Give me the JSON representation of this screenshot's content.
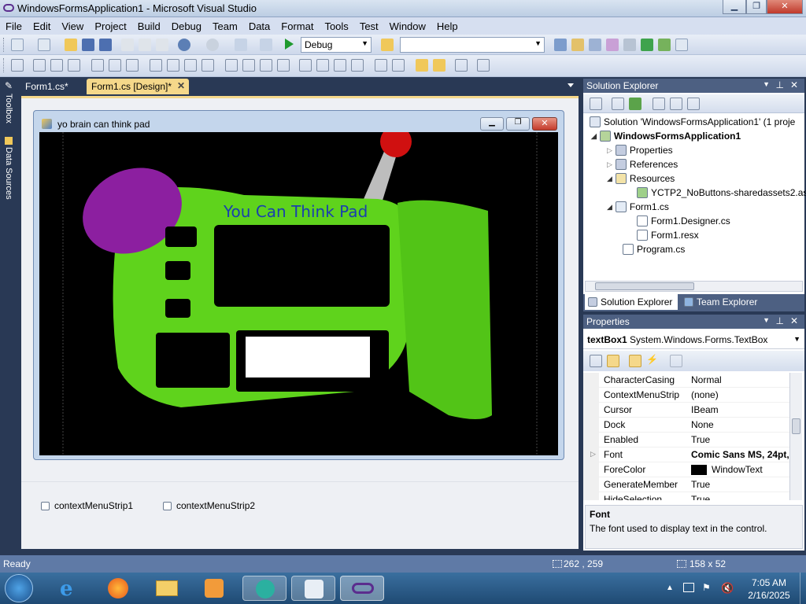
{
  "window": {
    "title": "WindowsFormsApplication1 - Microsoft Visual Studio"
  },
  "menu": [
    "File",
    "Edit",
    "View",
    "Project",
    "Build",
    "Debug",
    "Team",
    "Data",
    "Format",
    "Tools",
    "Test",
    "Window",
    "Help"
  ],
  "toolbar": {
    "config": "Debug"
  },
  "side_tabs": {
    "toolbox": "Toolbox",
    "data_sources": "Data Sources"
  },
  "doc_tabs": [
    "Form1.cs*",
    "Form1.cs [Design]*"
  ],
  "form": {
    "title": "yo brain can think pad",
    "canvas_text": "You Can Think Pad"
  },
  "tray": [
    "contextMenuStrip1",
    "contextMenuStrip2"
  ],
  "solution_explorer": {
    "title": "Solution Explorer",
    "items": [
      "Solution 'WindowsFormsApplication1' (1 proje",
      "WindowsFormsApplication1",
      "Properties",
      "References",
      "Resources",
      "YCTP2_NoButtons-sharedassets2.as",
      "Form1.cs",
      "Form1.Designer.cs",
      "Form1.resx",
      "Program.cs"
    ],
    "tabs": [
      "Solution Explorer",
      "Team Explorer"
    ]
  },
  "properties": {
    "title": "Properties",
    "object_name": "textBox1",
    "object_type": "System.Windows.Forms.TextBox",
    "rows": [
      {
        "name": "CharacterCasing",
        "value": "Normal"
      },
      {
        "name": "ContextMenuStrip",
        "value": "(none)"
      },
      {
        "name": "Cursor",
        "value": "IBeam"
      },
      {
        "name": "Dock",
        "value": "None"
      },
      {
        "name": "Enabled",
        "value": "True"
      },
      {
        "name": "Font",
        "value": "Comic Sans MS, 24pt,"
      },
      {
        "name": "ForeColor",
        "value": "WindowText"
      },
      {
        "name": "GenerateMember",
        "value": "True"
      },
      {
        "name": "HideSelection",
        "value": "True"
      }
    ],
    "desc_title": "Font",
    "desc_text": "The font used to display text in the control."
  },
  "status": {
    "text": "Ready",
    "pos": "262 , 259",
    "size": "158 x 52"
  },
  "taskbar": {
    "time": "7:05 AM",
    "date": "2/16/2025"
  },
  "colors": {
    "ide_dark": "#293955",
    "pad_green": "#5fd31c",
    "pad_purple": "#8c1fa0",
    "pad_text": "#1a3fae"
  }
}
